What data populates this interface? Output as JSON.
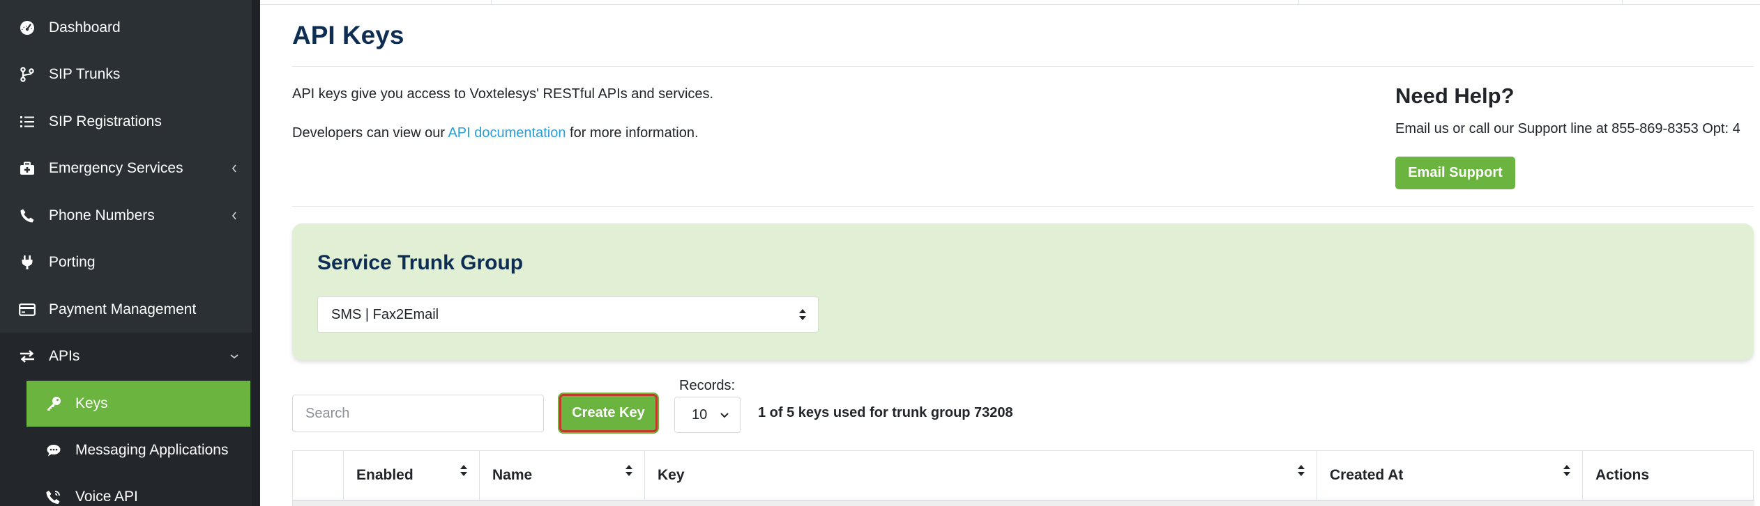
{
  "sidebar": {
    "items": [
      {
        "label": "Dashboard",
        "icon": "dashboard-icon"
      },
      {
        "label": "SIP Trunks",
        "icon": "branch-icon"
      },
      {
        "label": "SIP Registrations",
        "icon": "list-icon"
      },
      {
        "label": "Emergency Services",
        "icon": "medkit-icon",
        "has_submenu": true
      },
      {
        "label": "Phone Numbers",
        "icon": "phone-icon",
        "has_submenu": true
      },
      {
        "label": "Porting",
        "icon": "plug-icon"
      },
      {
        "label": "Payment Management",
        "icon": "credit-card-icon"
      },
      {
        "label": "APIs",
        "icon": "exchange-icon",
        "expanded": true
      }
    ],
    "subitems": [
      {
        "label": "Keys",
        "icon": "key-icon",
        "active": true
      },
      {
        "label": "Messaging Applications",
        "icon": "chat-icon"
      },
      {
        "label": "Voice API",
        "icon": "phone-volume-icon"
      }
    ]
  },
  "page": {
    "title": "API Keys",
    "intro_line1": "API keys give you access to Voxtelesys' RESTful APIs and services.",
    "intro_line2_prefix": "Developers can view our ",
    "intro_line2_link": "API documentation",
    "intro_line2_suffix": " for more information."
  },
  "help": {
    "title": "Need Help?",
    "text": "Email us or call our Support line at 855-869-8353 Opt: 4",
    "button": "Email Support"
  },
  "trunk_group": {
    "title": "Service Trunk Group",
    "selected": "SMS | Fax2Email"
  },
  "controls": {
    "search_placeholder": "Search",
    "create_key": "Create Key",
    "records_label": "Records:",
    "records_value": "10",
    "keys_used": "1 of 5 keys used for trunk group 73208"
  },
  "table": {
    "columns": [
      "",
      "Enabled",
      "Name",
      "Key",
      "Created At",
      "Actions"
    ]
  },
  "colors": {
    "sidebar": "#2b3035",
    "accent_green": "#6ab43f",
    "title_navy": "#0d2d52",
    "link": "#2a9fd6",
    "card_bg": "#e1f0d5"
  }
}
